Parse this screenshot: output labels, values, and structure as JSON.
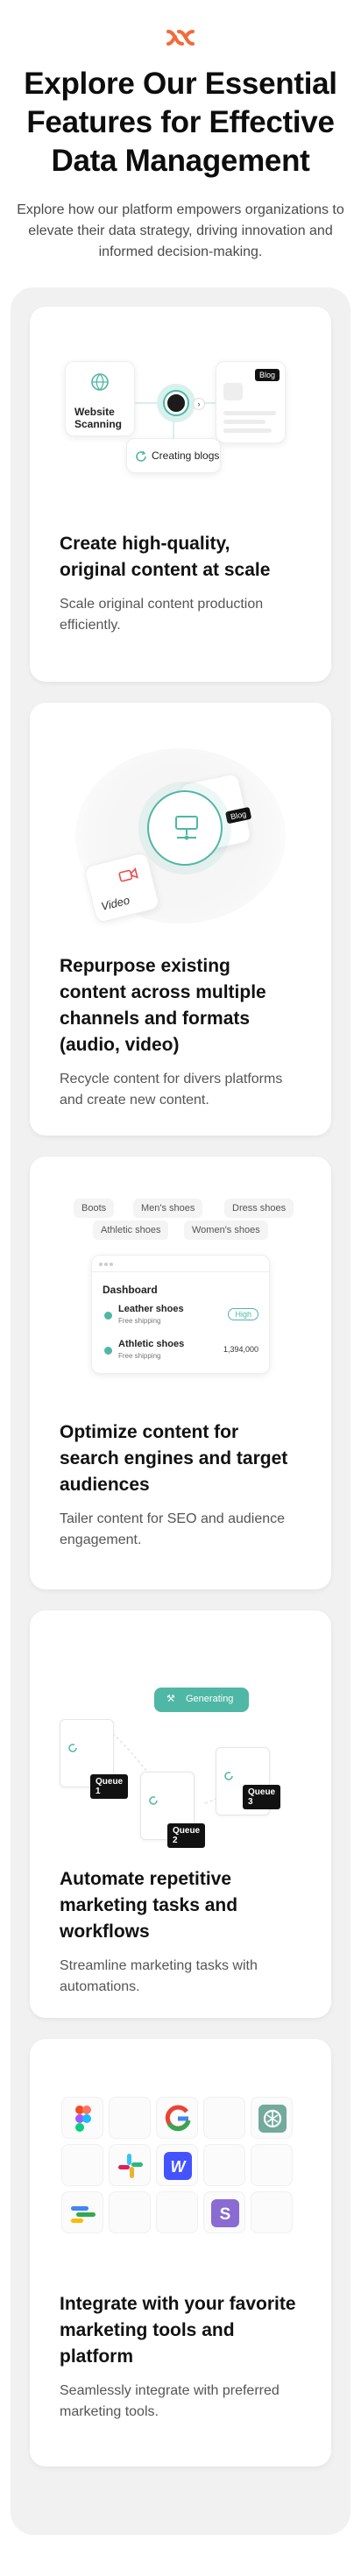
{
  "header": {
    "headline": "Explore Our Essential Features for Effective Data Management",
    "subheading": "Explore how our platform empowers organizations to elevate their data strategy, driving innovation and informed decision-making."
  },
  "colors": {
    "accent": "#f26b3a",
    "teal": "#4fb7a5",
    "dark": "#111111"
  },
  "features": [
    {
      "title": "Create high-quality, original content at scale",
      "description": "Scale original content production efficiently.",
      "illustration": {
        "source_label": "Website Scanning",
        "badge": "Blog",
        "status": "Creating blogs"
      }
    },
    {
      "title": "Repurpose existing content across multiple channels and formats (audio, video)",
      "description": "Recycle content for divers platforms and create new content.",
      "illustration": {
        "video_label": "Video",
        "badge": "Blog"
      }
    },
    {
      "title": "Optimize content for search engines and target audiences",
      "description": "Tailer content for SEO and audience engagement.",
      "illustration": {
        "keywords": [
          "Boots",
          "Men's shoes",
          "Dress shoes",
          "Athletic shoes",
          "Women's shoes"
        ],
        "dashboard_title": "Dashboard",
        "rows": [
          {
            "name": "Leather shoes",
            "meta": "Free shipping",
            "value": "High"
          },
          {
            "name": "Athletic shoes",
            "meta": "Free shipping",
            "value": "1,394,000"
          }
        ]
      }
    },
    {
      "title": "Automate  repetitive marketing tasks and workflows",
      "description": "Streamline marketing tasks with automations.",
      "illustration": {
        "status": "Generating",
        "queues": [
          "Queue 1",
          "Queue 2",
          "Queue 3"
        ]
      }
    },
    {
      "title": "Integrate with your favorite marketing tools and platform",
      "description": "Seamlessly integrate with preferred marketing tools.",
      "illustration": {
        "tools": [
          "figma-icon",
          "google-icon",
          "openai-icon",
          "slack-icon",
          "webflow-icon",
          "google-analytics-icon",
          "stripe-icon"
        ]
      }
    }
  ]
}
